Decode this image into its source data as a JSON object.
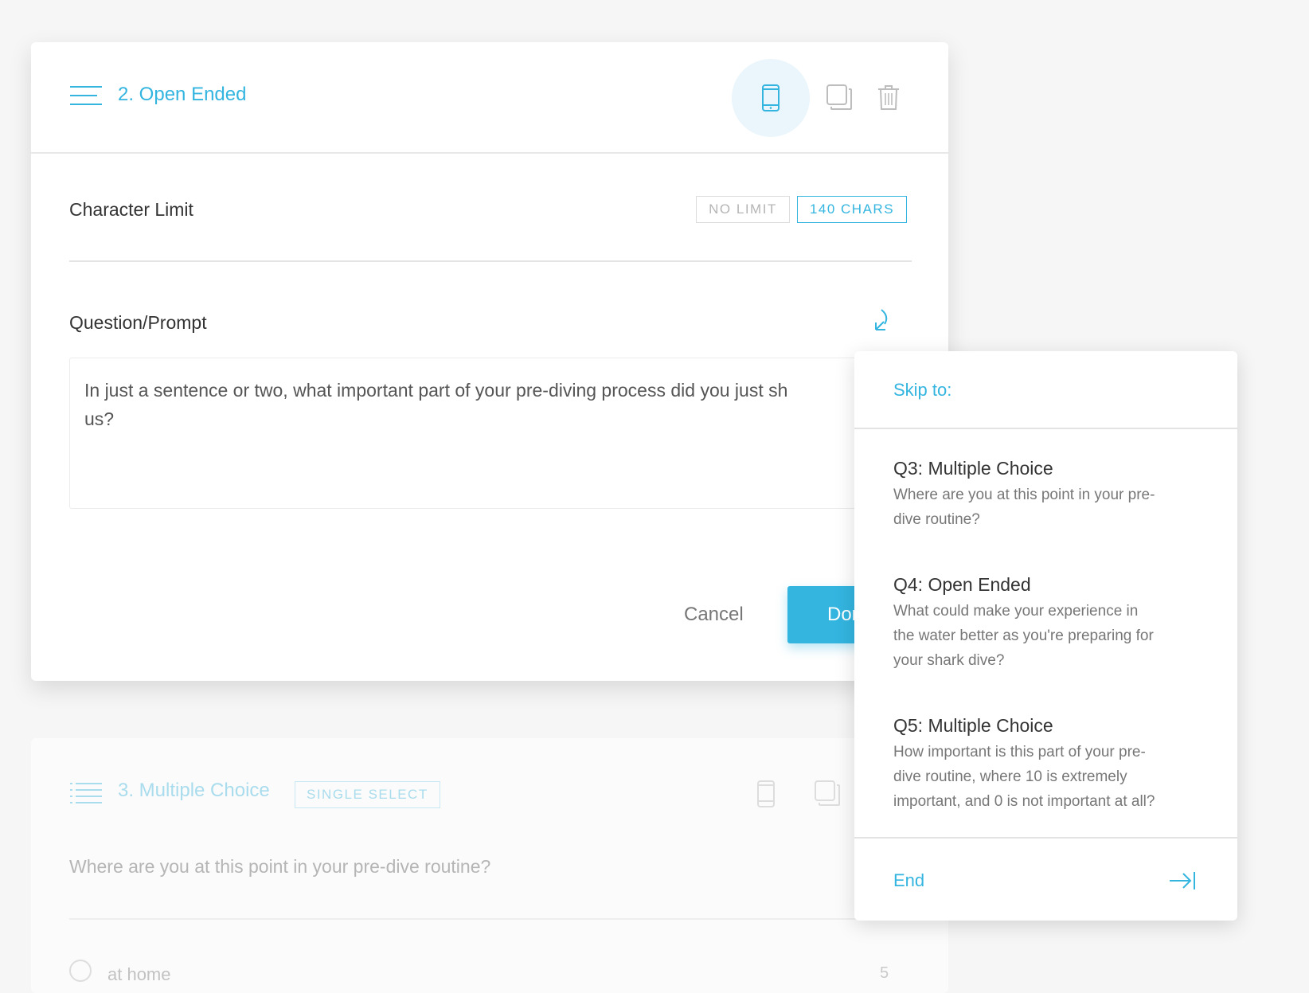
{
  "card": {
    "title": "2. Open Ended",
    "character_limit": {
      "label": "Character Limit",
      "options": [
        "NO LIMIT",
        "140 CHARS"
      ],
      "selected": "140 CHARS"
    },
    "question_label": "Question/Prompt",
    "prompt_lines": [
      "In just a sentence or two, what important part of your pre-diving process did you just sh",
      "us?"
    ],
    "cancel_label": "Cancel",
    "done_label": "Done",
    "icons": [
      "hamburger-icon",
      "mobile-preview-icon",
      "duplicate-icon",
      "trash-icon",
      "skip-logic-icon"
    ]
  },
  "background_card": {
    "title": "3. Multiple Choice",
    "badge": "SINGLE SELECT",
    "question": "Where are you at this point in your pre-dive routine?",
    "option": "at home",
    "option_number": "5"
  },
  "skip_dropdown": {
    "header": "Skip to:",
    "items": [
      {
        "title": "Q3: Multiple Choice",
        "desc": [
          "Where are you at this point in your pre-",
          "dive routine?"
        ]
      },
      {
        "title": "Q4: Open Ended",
        "desc": [
          "What could make your experience in",
          "the water better as you're preparing for",
          "your shark dive?"
        ]
      },
      {
        "title": "Q5: Multiple Choice",
        "desc": [
          "How important is this part of your pre-",
          "dive routine, where 10 is extremely",
          "important, and 0 is not important at all?"
        ]
      }
    ],
    "end_label": "End"
  },
  "colors": {
    "accent": "#33b5e0",
    "background": "#f6f6f6",
    "card": "#ffffff"
  }
}
